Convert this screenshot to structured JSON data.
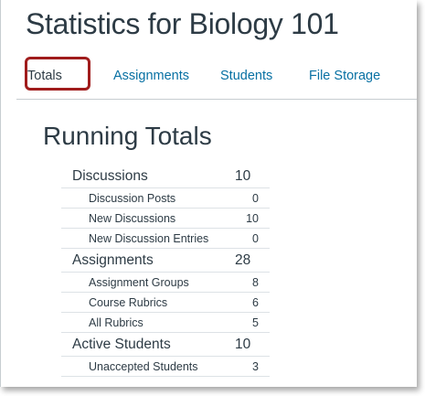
{
  "page": {
    "title": "Statistics for Biology 101"
  },
  "tabs": [
    {
      "label": "Totals",
      "active": true
    },
    {
      "label": "Assignments",
      "active": false
    },
    {
      "label": "Students",
      "active": false
    },
    {
      "label": "File Storage",
      "active": false
    }
  ],
  "section": {
    "title": "Running Totals"
  },
  "colors": {
    "link": "#0770a3",
    "text": "#2d3b45",
    "highlight": "#a01c1c"
  },
  "stats": {
    "discussions": {
      "label": "Discussions",
      "value": "10",
      "items": [
        {
          "label": "Discussion Posts",
          "value": "0"
        },
        {
          "label": "New Discussions",
          "value": "10"
        },
        {
          "label": "New Discussion Entries",
          "value": "0"
        }
      ]
    },
    "assignments": {
      "label": "Assignments",
      "value": "28",
      "items": [
        {
          "label": "Assignment Groups",
          "value": "8"
        },
        {
          "label": "Course Rubrics",
          "value": "6"
        },
        {
          "label": "All Rubrics",
          "value": "5"
        }
      ]
    },
    "active_students": {
      "label": "Active Students",
      "value": "10",
      "items": [
        {
          "label": "Unaccepted Students",
          "value": "3"
        }
      ]
    }
  }
}
